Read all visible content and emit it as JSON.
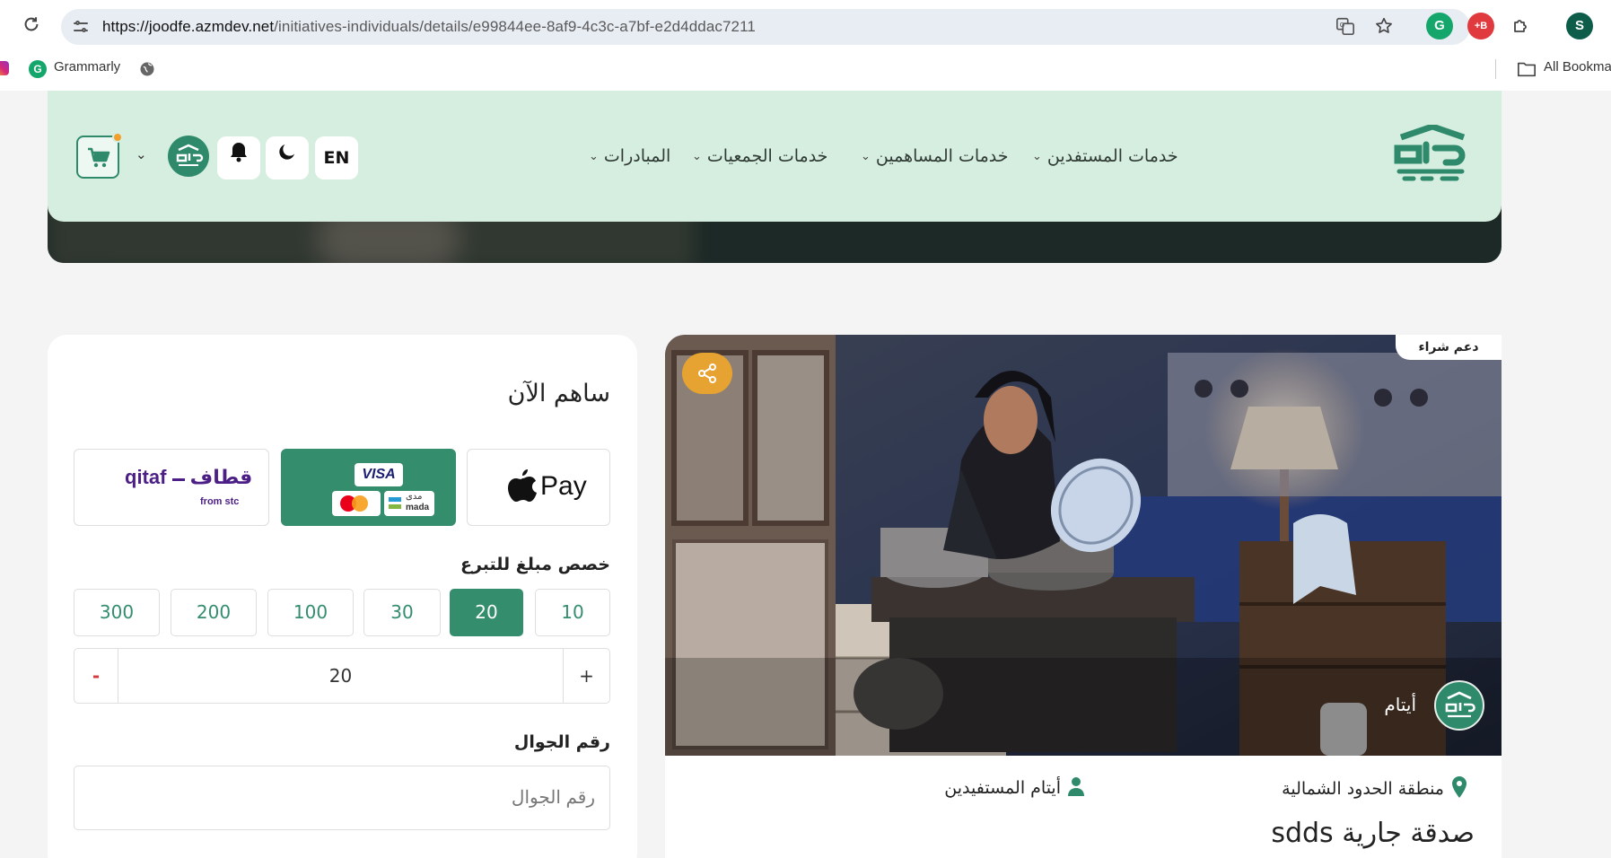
{
  "browser": {
    "url_host": "https://joodfe.azmdev.net",
    "url_path": "/initiatives-individuals/details/e99844ee-8af9-4c3c-a7bf-e2d4ddac7211",
    "profile_initial": "S",
    "extension_badge": "+B",
    "bookmarks": {
      "grammarly": "Grammarly",
      "all_bookmarks": "All Bookma"
    }
  },
  "navbar": {
    "menu": [
      {
        "label": "خدمات المستفدين"
      },
      {
        "label": "خدمات المساهمين"
      },
      {
        "label": "خدمات الجمعيات"
      },
      {
        "label": "المبادرات"
      }
    ],
    "lang_button": "EN",
    "accent_color": "#2f8a6c"
  },
  "donate": {
    "title": "ساهم الآن",
    "payment_methods": {
      "apple_pay": "Pay",
      "visa": "VISA",
      "mada_en": "mada",
      "mada_ar": "مدى",
      "qitaf_en": "qitaf",
      "qitaf_ar": "قطاف",
      "qitaf_sub": "from stc"
    },
    "amount_label": "خصص مبلغ للتبرع",
    "amounts": [
      "10",
      "20",
      "30",
      "100",
      "200",
      "300"
    ],
    "selected_amount": "20",
    "stepper": {
      "minus": "-",
      "plus": "+",
      "value": "20"
    },
    "phone_label": "رقم الجوال",
    "phone_placeholder": "رقم الجوال"
  },
  "initiative": {
    "tag": "دعم شراء",
    "org_name": "أيتام",
    "region": "منطقة الحدود الشمالية",
    "beneficiaries": "أيتام المستفيدين",
    "title": "صدقة جارية sdds"
  }
}
